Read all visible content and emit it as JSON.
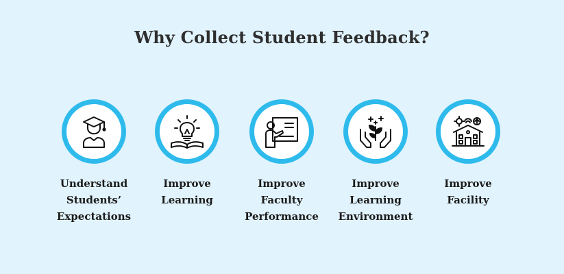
{
  "title": "Why Collect Student Feedback?",
  "accent_color": "#2ebbec",
  "background_color": "#e1f3fd",
  "items": [
    {
      "icon": "graduate-student-icon",
      "label_lines": [
        "Understand",
        "Students’",
        "Expectations"
      ]
    },
    {
      "icon": "lightbulb-book-icon",
      "label_lines": [
        "Improve",
        "Learning"
      ]
    },
    {
      "icon": "teacher-board-icon",
      "label_lines": [
        "Improve",
        "Faculty",
        "Performance"
      ]
    },
    {
      "icon": "hands-plant-icon",
      "label_lines": [
        "Improve",
        "Learning",
        "Environment"
      ]
    },
    {
      "icon": "smart-building-icon",
      "label_lines": [
        "Improve",
        "Facility"
      ]
    }
  ]
}
